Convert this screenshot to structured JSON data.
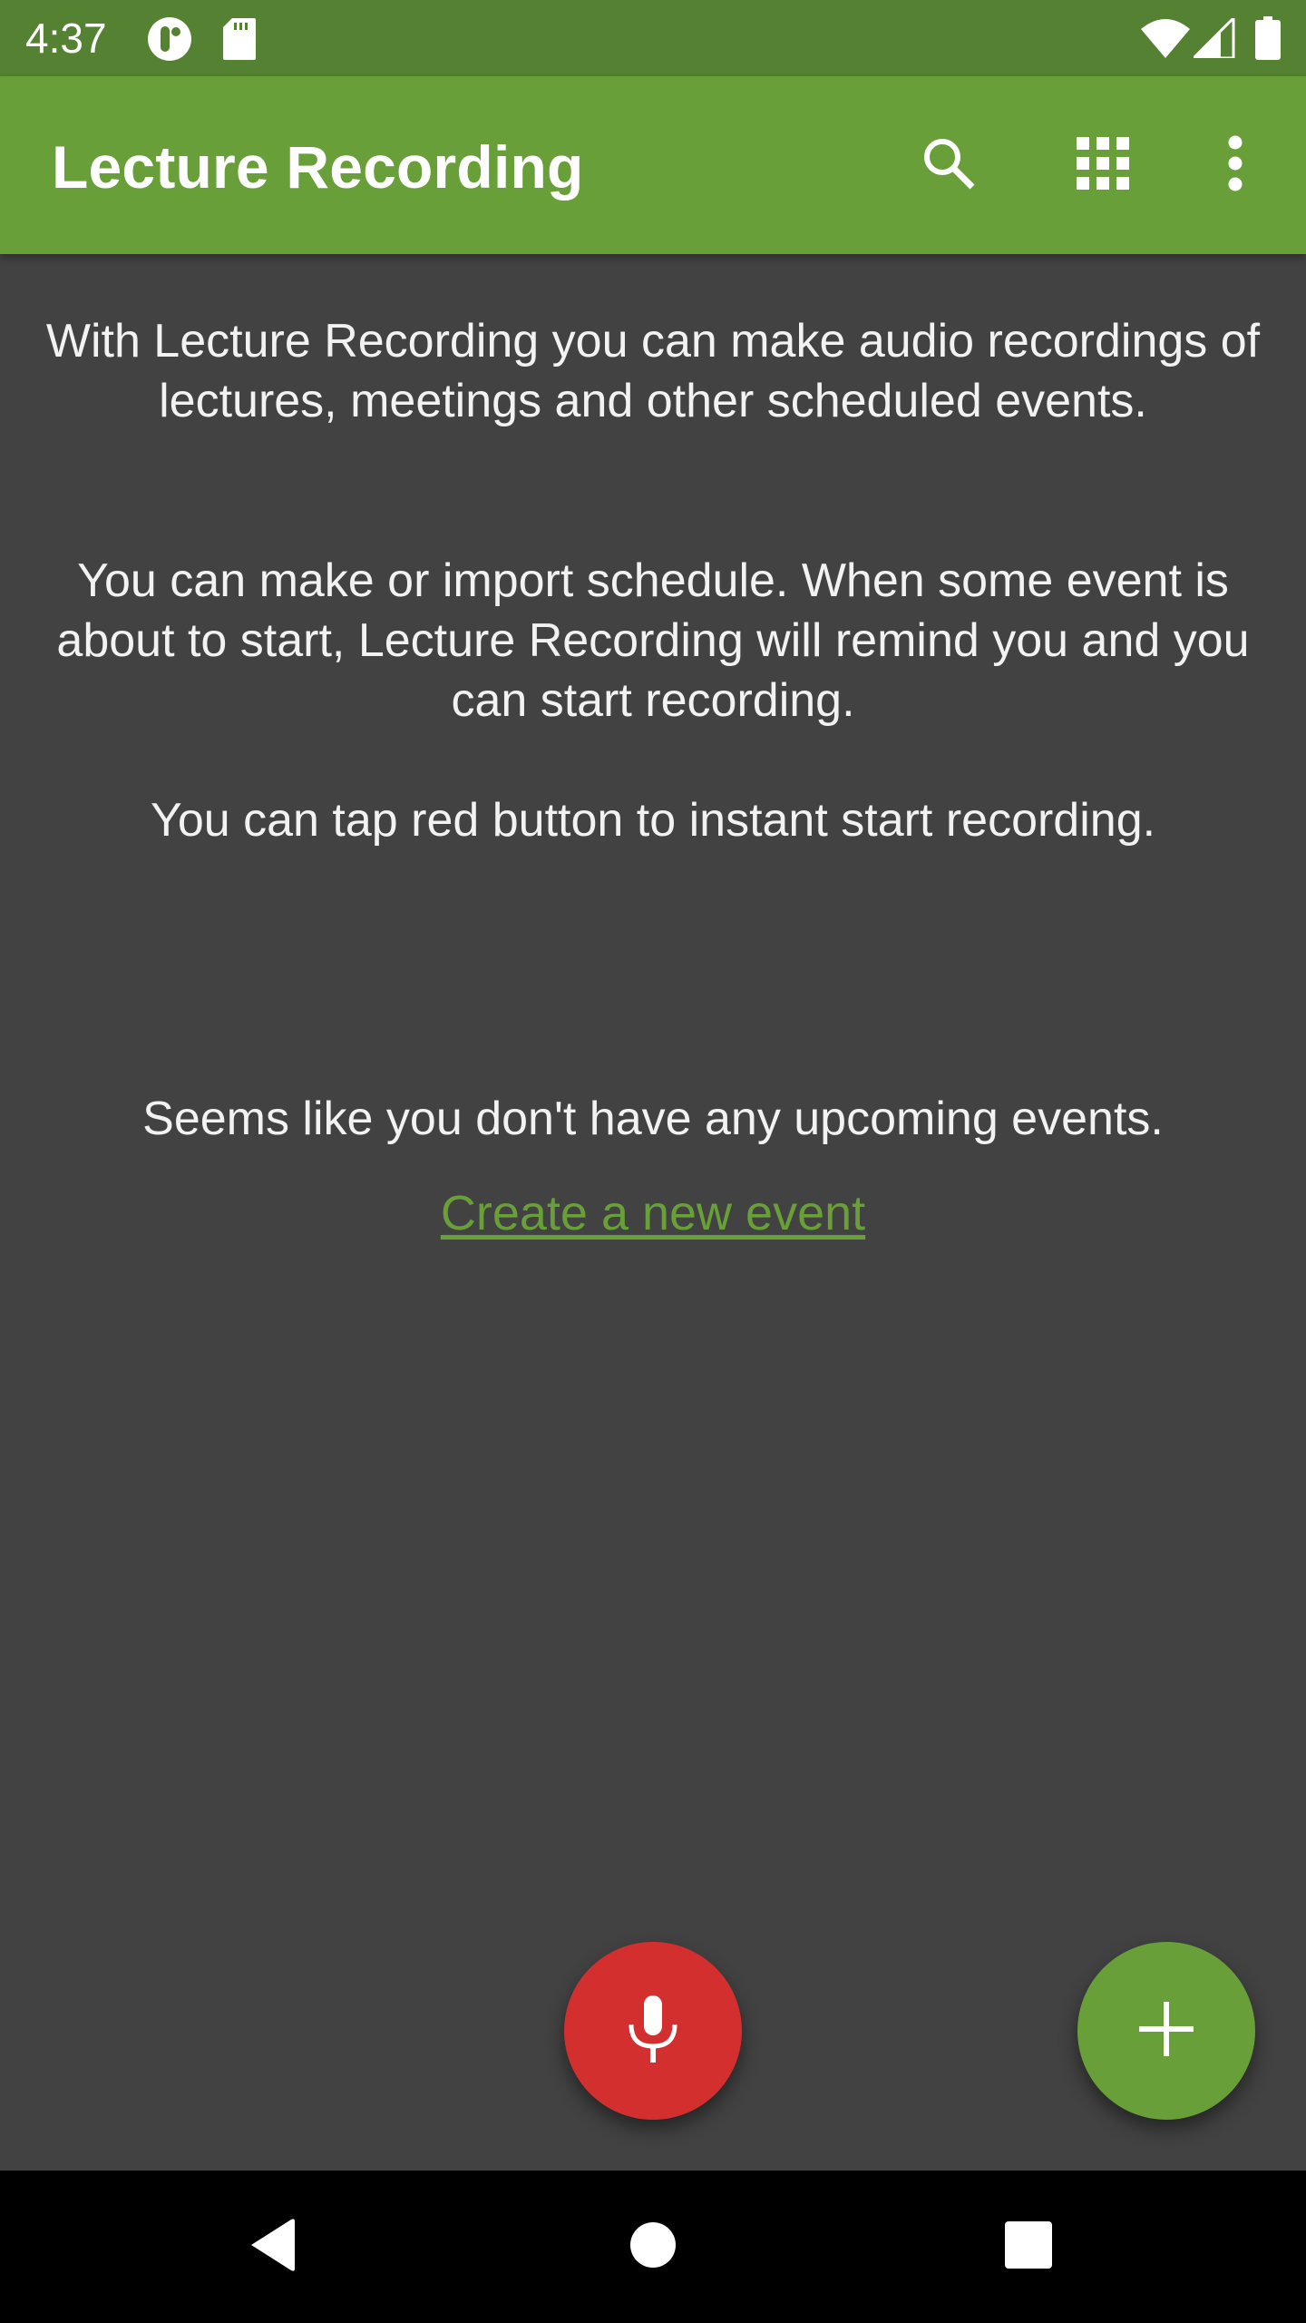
{
  "status_bar": {
    "time": "4:37",
    "left_icons": [
      "notification-app-icon",
      "sd-card-icon"
    ],
    "right_icons": [
      "wifi-icon",
      "cell-signal-icon",
      "battery-icon"
    ]
  },
  "app_bar": {
    "title": "Lecture Recording",
    "actions": [
      {
        "name": "search",
        "icon": "search-icon"
      },
      {
        "name": "apps-grid",
        "icon": "grid-icon"
      },
      {
        "name": "overflow-menu",
        "icon": "more-vert-icon"
      }
    ]
  },
  "intro": {
    "paragraph_1": "With Lecture Recording you can make audio recordings of lectures, meetings and other scheduled events.",
    "paragraph_2": "You can make or import schedule. When some event is about to start, Lecture Recording will remind you and you can start recording.",
    "paragraph_3": "You can tap red button to instant start recording."
  },
  "empty_state": {
    "message": "Seems like you don't have any upcoming events.",
    "link_label": "Create a new event"
  },
  "fabs": {
    "record": {
      "icon": "microphone-icon",
      "color": "#d32f2f"
    },
    "add": {
      "icon": "plus-icon",
      "color": "#689f38"
    }
  },
  "colors": {
    "primary": "#689f38",
    "primary_dark": "#548132",
    "background": "#424242",
    "record_red": "#d32f2f"
  },
  "nav_bar": {
    "buttons": [
      "back",
      "home",
      "recents"
    ]
  }
}
